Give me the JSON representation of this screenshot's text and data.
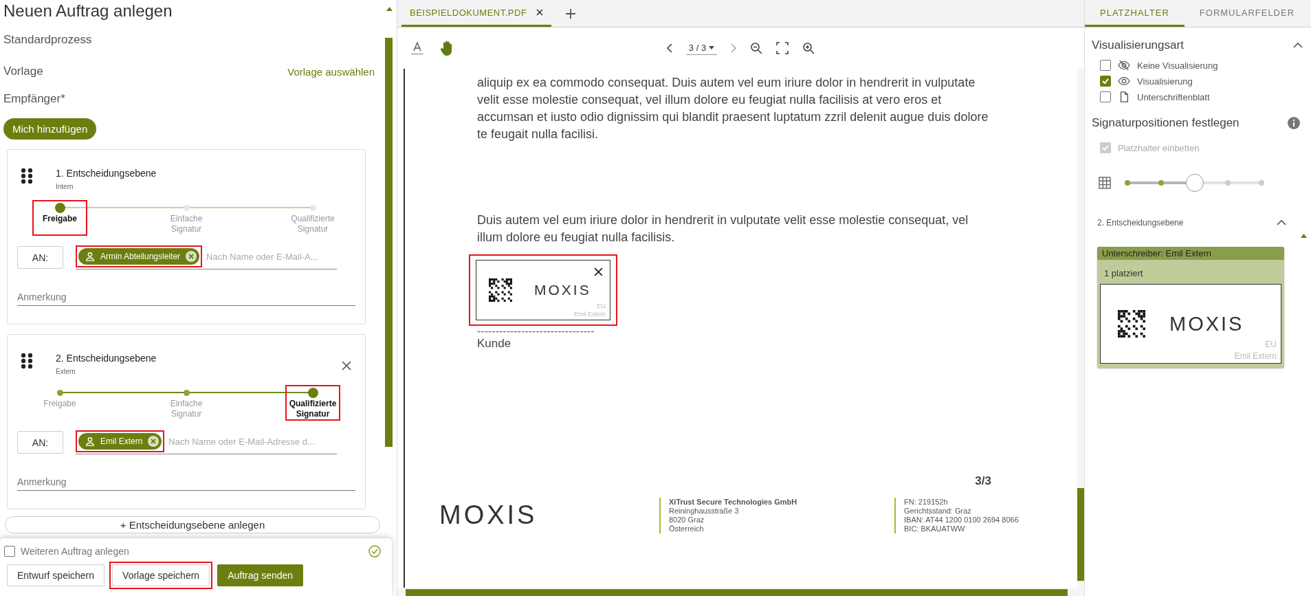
{
  "left": {
    "title": "Neuen Auftrag anlegen",
    "process": "Standardprozess",
    "template_label": "Vorlage",
    "template_link": "Vorlage auswählen",
    "recipients_label": "Empfänger*",
    "add_me": "Mich hinzufügen",
    "levels": [
      {
        "title": "1. Entscheidungsebene",
        "subtitle": "Intern",
        "removable": false,
        "steps": [
          {
            "label": "Freigabe",
            "selected": true,
            "highlighted": true
          },
          {
            "label": "Einfache Signatur",
            "selected": false,
            "highlighted": false
          },
          {
            "label": "Qualifizierte Signatur",
            "selected": false,
            "highlighted": false
          }
        ],
        "to": "AN:",
        "chip": {
          "name": "Armin Abteilungsleiter",
          "highlighted": true
        },
        "search_placeholder": "Nach Name oder E-Mail-A...",
        "note_placeholder": "Anmerkung"
      },
      {
        "title": "2. Entscheidungsebene",
        "subtitle": "Extern",
        "removable": true,
        "steps": [
          {
            "label": "Freigabe",
            "selected": false,
            "highlighted": false
          },
          {
            "label": "Einfache Signatur",
            "selected": false,
            "highlighted": false
          },
          {
            "label": "Qualifizierte Signatur",
            "selected": true,
            "highlighted": true
          }
        ],
        "to": "AN:",
        "chip": {
          "name": "Emil Extern",
          "highlighted": true
        },
        "search_placeholder": "Nach Name oder E-Mail-Adresse d...",
        "note_placeholder": "Anmerkung"
      }
    ],
    "add_level": "+ Entscheidungsebene anlegen",
    "another": {
      "label": "Weiteren Auftrag anlegen",
      "checked": false
    },
    "buttons": [
      {
        "label": "Entwurf speichern",
        "kind": "outline",
        "highlighted": false
      },
      {
        "label": "Vorlage speichern",
        "kind": "outline",
        "highlighted": true
      },
      {
        "label": "Auftrag senden",
        "kind": "primary",
        "highlighted": false
      }
    ]
  },
  "viewer": {
    "tabs": [
      {
        "label": "BEISPIELDOKUMENT.PDF",
        "selected": true
      }
    ],
    "page_indicator": "3 / 3",
    "paragraphs": [
      "aliquip ex ea commodo consequat. Duis autem vel eum iriure dolor in hendrerit in vulputate velit esse molestie consequat, vel illum dolore eu feugiat nulla facilisis at vero eros et accumsan et iusto odio dignissim qui blandit praesent luptatum zzril delenit augue duis dolore te feugait nulla facilisi.",
      "Duis autem vel eum iriure dolor in hendrerit in vulputate velit esse molestie consequat, vel illum dolore eu feugiat nulla facilisis."
    ],
    "stamp": {
      "logo": "MOXIS",
      "region": "EU",
      "signer": "Emil Extern",
      "highlighted": true
    },
    "signature_line": "--------------------------------",
    "signature_label": "Kunde",
    "page_number": "3/3",
    "footer": {
      "logo": "MOXIS",
      "company": [
        "XiTrust Secure Technologies GmbH",
        "Reininghausstraße 3",
        "8020 Graz",
        "Österreich"
      ],
      "legal": [
        "FN: 219152h",
        "Gerichtsstand: Graz",
        "IBAN: AT44 1200 0100 2694 8066",
        "BIC: BKAUATWW"
      ]
    }
  },
  "right": {
    "tabs": [
      {
        "label": "PLATZHALTER",
        "selected": true
      },
      {
        "label": "FORMULARFELDER",
        "selected": false
      }
    ],
    "visualization_title": "Visualisierungsart",
    "options": [
      {
        "label": "Keine Visualisierung",
        "kind": "hidden",
        "checked": false
      },
      {
        "label": "Visualisierung",
        "kind": "visible",
        "checked": true
      },
      {
        "label": "Unterschriftenblatt",
        "kind": "page",
        "checked": false
      }
    ],
    "positions_title": "Signaturpositionen festlegen",
    "embed": {
      "label": "Platzhalter einbetten",
      "checked": true,
      "disabled": true
    },
    "grid_slider": {
      "level": 0.5
    },
    "level_title": "2. Entscheidungsebene",
    "signer_card": {
      "header": "Unterschreiber: Emil Extern",
      "placed": "1 platziert",
      "logo": "MOXIS",
      "region": "EU",
      "signer": "Emil Extern"
    }
  }
}
